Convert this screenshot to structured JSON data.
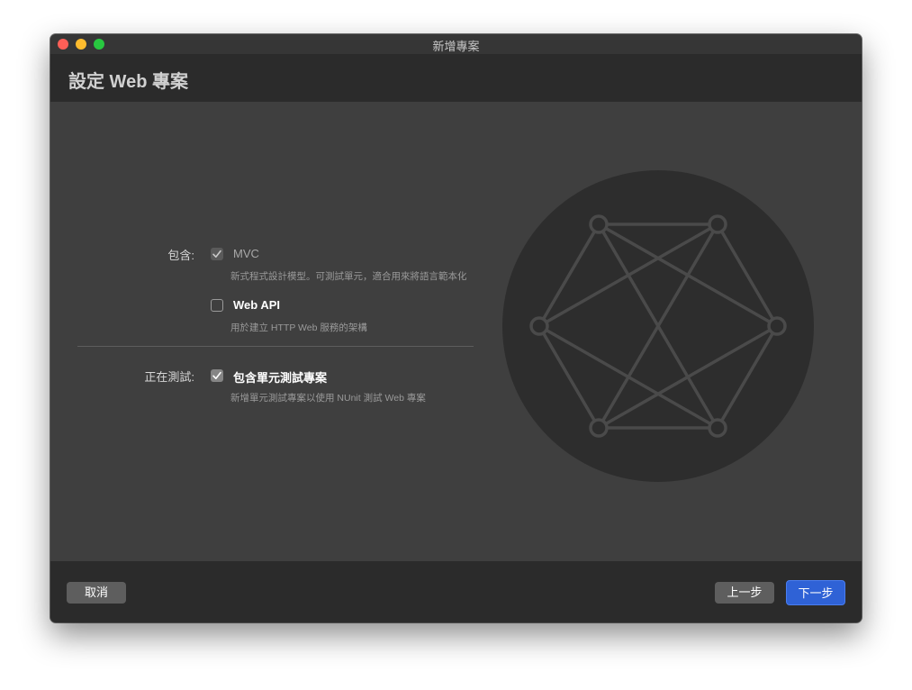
{
  "window": {
    "title": "新增專案"
  },
  "header": {
    "title": "設定 Web 專案"
  },
  "include_section": {
    "label": "包含:",
    "options": [
      {
        "label": "MVC",
        "description": "新式程式設計模型。可測試單元，適合用來將語言範本化",
        "checked": true,
        "enabled": false
      },
      {
        "label": "Web API",
        "description": "用於建立 HTTP Web 服務的架構",
        "checked": false,
        "enabled": true
      }
    ]
  },
  "testing_section": {
    "label": "正在測試:",
    "options": [
      {
        "label": "包含單元測試專案",
        "description": "新增單元測試專案以使用 NUnit 測試 Web 專案",
        "checked": true,
        "enabled": true
      }
    ]
  },
  "footer": {
    "cancel_label": "取消",
    "back_label": "上一步",
    "next_label": "下一步"
  },
  "icons": {
    "hero": "network-graph-icon",
    "check": "checkmark-icon"
  },
  "colors": {
    "accent": "#2f62d6",
    "window_bg": "#3f3f3f",
    "header_bg": "#2b2b2b",
    "hero_circle": "#2d2d2d",
    "hero_lines": "#4a4a4a"
  }
}
